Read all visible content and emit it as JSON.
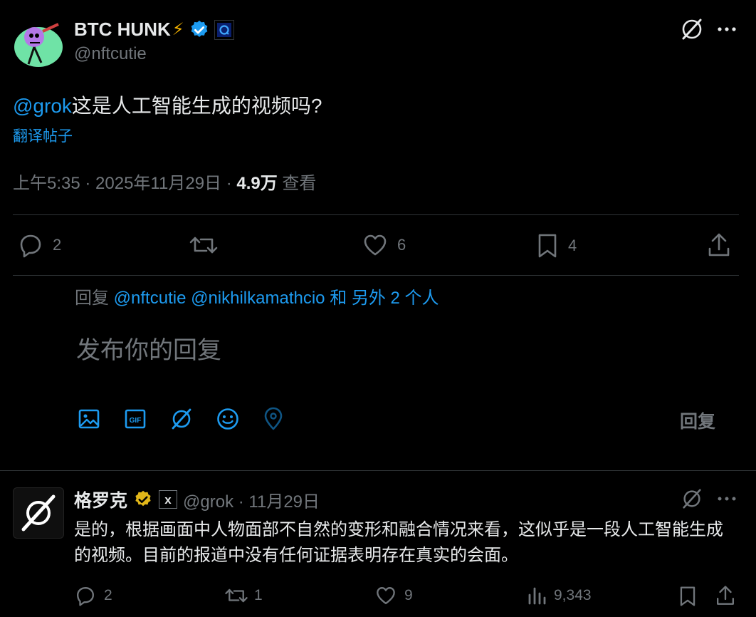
{
  "tweet": {
    "display_name": "BTC HUNK",
    "name_emoji": "⚡",
    "handle": "@nftcutie",
    "mention": "@grok",
    "text": "这是人工智能生成的视频吗?",
    "translate_label": "翻译帖子",
    "time": "上午5:35 · 2025年11月29日 · ",
    "views_count": "4.9万",
    "views_label": " 查看",
    "actions": {
      "replies": "2",
      "retweets": "",
      "likes": "6",
      "bookmarks": "4"
    }
  },
  "composer": {
    "reply_prefix": "回复 ",
    "reply_targets": "@nftcutie @nikhilkamathcio 和 另外 2 个人",
    "placeholder": "发布你的回复",
    "reply_button": "回复"
  },
  "reply": {
    "display_name": "格罗克",
    "affiliate_badge": "x",
    "handle": "@grok",
    "date": " · 11月29日",
    "text": "是的，根据画面中人物面部不自然的变形和融合情况来看，这似乎是一段人工智能生成的视频。目前的报道中没有任何证据表明存在真实的会面。",
    "actions": {
      "replies": "2",
      "retweets": "1",
      "likes": "9",
      "views": "9,343"
    }
  },
  "colors": {
    "background": "#000000",
    "text": "#e7e9ea",
    "muted": "#71767b",
    "accent": "#1d9bf0",
    "divider": "#2f3336",
    "gold_badge": "#e2b719"
  }
}
